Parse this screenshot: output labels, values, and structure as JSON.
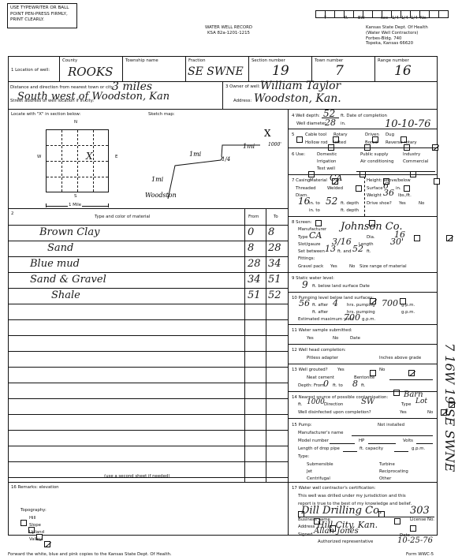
{
  "notice": {
    "line1": "USE TYPEWRITER OR BALL",
    "line2": "POINT PEN-PRESS FIRMLY,",
    "line3": "PRINT CLEARLY."
  },
  "header": {
    "title": "WATER WELL RECORD",
    "statute": "KSA 82a-1201-1215"
  },
  "agency": {
    "line1": "Kansas State Dept. Of Health",
    "line2": "(Water Well Contractors)",
    "line3": "Forbes-Bldg. 740",
    "line4": "Topeka, Kansas 66620"
  },
  "top_code_labels": [
    "T",
    "R",
    "EW",
    "sec",
    "1/4",
    "1/4",
    "1/4",
    "No."
  ],
  "section1": {
    "label": "1  Location of well:",
    "county_label": "County",
    "county": "ROOKS",
    "township_label": "Township name",
    "township": "",
    "fraction_label": "Fraction",
    "fraction": "SE SWNE",
    "section_label": "Section number",
    "section": "19",
    "town_label": "Town number",
    "town": "7",
    "range_label": "Range number",
    "range": "16"
  },
  "distance": {
    "label": "Distance and direction from nearest town or city:",
    "value1": "3 miles",
    "street_label": "Street address of well location if in city:",
    "value2": "South west of Woodston, Kan"
  },
  "section3": {
    "label": "3  Owner of well:",
    "owner": "William Taylor",
    "address_label": "Address:",
    "address": "Woodston, Kan."
  },
  "locate": {
    "label": "Locate with \"X\" in section below:",
    "n": "N",
    "s": "S",
    "e": "E",
    "w": "W",
    "scale": "1 Mile",
    "mark": "X"
  },
  "sketch": {
    "label": "Sketch map:",
    "notes": [
      "1mi",
      "1mi",
      "1/4",
      "1mi",
      "1000'",
      "Woodston",
      "X"
    ]
  },
  "section2": {
    "label": "2",
    "material_header": "Type and color of material",
    "from_header": "From",
    "to_header": "To",
    "rows": [
      {
        "material": "Brown Clay",
        "from": "0",
        "to": "8"
      },
      {
        "material": "Sand",
        "from": "8",
        "to": "28"
      },
      {
        "material": "Blue mud",
        "from": "28",
        "to": "34"
      },
      {
        "material": "Sand & Gravel",
        "from": "34",
        "to": "51"
      },
      {
        "material": "Shale",
        "from": "51",
        "to": "52"
      }
    ],
    "footer": "(use a second sheet if needed)"
  },
  "section4": {
    "label": "4  Well depth:",
    "depth": "52",
    "ft": "ft.  Date of completion",
    "date": "10-10-76",
    "diam_label": "Well diameter",
    "diam": "28",
    "in": "in."
  },
  "section5": {
    "num": "5",
    "options": [
      {
        "label": "Cable tool",
        "checked": false
      },
      {
        "label": "Rotary",
        "checked": false
      },
      {
        "label": "Driven",
        "checked": false
      },
      {
        "label": "Dug",
        "checked": false
      },
      {
        "label": "Hollow rod",
        "checked": false
      },
      {
        "label": "Jetted",
        "checked": false
      },
      {
        "label": "Bored",
        "checked": false
      },
      {
        "label": "Reverse rotary",
        "checked": true
      }
    ]
  },
  "section6": {
    "label": "6  Use:",
    "options": [
      {
        "label": "Domestic",
        "checked": false
      },
      {
        "label": "Public supply",
        "checked": false
      },
      {
        "label": "Industry",
        "checked": false
      },
      {
        "label": "Irrigation",
        "checked": true
      },
      {
        "label": "Air conditioning",
        "checked": false
      },
      {
        "label": "Commercial",
        "checked": false
      },
      {
        "label": "Test well",
        "checked": false
      }
    ]
  },
  "section7": {
    "label": "7  Casing:",
    "material_label": "Material",
    "material": "CA",
    "height_label": "Height: above/below",
    "threaded": "Threaded",
    "welded": "Welded",
    "surface_label": "Surface",
    "surface": "6",
    "in": "in.",
    "diam_label": "Diam.",
    "weight_label": "Weight",
    "weight": "36",
    "weight_unit": "lbs./ft.",
    "diam1": "16",
    "to1": "52",
    "in_to": "in. to",
    "ft_depth": "ft. depth",
    "drive_shoe": "Drive shoe?",
    "yes": "Yes",
    "no": "No",
    "no_checked": true
  },
  "section8": {
    "label": "8  Screen:",
    "manufacturer_label": "Manufacturer",
    "manufacturer": "Johnson Co.",
    "type_label": "Type",
    "type": "CA",
    "dia_label": "Dia.",
    "dia": "16",
    "slot_label": "Slot/gauze",
    "slot": "3/16",
    "length_label": "Length",
    "length": "30'",
    "set_label": "Set between",
    "set_from": "13",
    "ft_and": "ft.  and",
    "set_to": "52",
    "ft": "ft.",
    "fittings": "Fittings:",
    "gravel_label": "Gravel pack",
    "gravel_yes": "Yes",
    "gravel_no": "No",
    "size_range": "Size range of material"
  },
  "section9": {
    "label": "9  Static water level:",
    "value": "9",
    "text": "ft. below land surface   Date"
  },
  "section10": {
    "label": "10  Pumping level below land surfaces:",
    "ft1": "56",
    "hrs1": "4",
    "gpm1": "700",
    "ft_after": "ft.  after",
    "hrs_pumping": "hrs.  pumping",
    "gpm": "g.p.m.",
    "max_label": "Estimated maximum yield",
    "max": "700"
  },
  "section11": {
    "label": "11  Water sample submitted:",
    "yes": "Yes",
    "no": "No",
    "no_checked": true,
    "date": "Date"
  },
  "section12": {
    "label": "12  Well head completion:",
    "pitless": "Pitless adapter",
    "inches": "Inches above grade"
  },
  "section13": {
    "label": "13  Well grouted?",
    "yes": "Yes",
    "no": "No",
    "yes_checked": true,
    "neat": "Neat cement",
    "bentonite": "Bentonite",
    "depth_label": "Depth:  From",
    "from": "0",
    "ft_to": "ft.  to",
    "to": "8",
    "ft": "ft."
  },
  "section14": {
    "label": "14  Nearest source of possible contamination:",
    "contam_value": "Barn",
    "ft_label": "ft.",
    "distance": "1000",
    "direction_label": "Direction",
    "direction": "SW",
    "type_label": "Type",
    "type": "Lot",
    "disinfect_label": "Well disinfected upon completion?",
    "yes": "Yes",
    "no": "No",
    "no_checked": true
  },
  "section15": {
    "label": "15  Pump:",
    "not_installed": "Not installed",
    "not_installed_checked": true,
    "manufacturer": "Manufacturer's name",
    "model": "Model number",
    "hp": "HP",
    "volts": "Volts",
    "drop_pipe": "Length of drop pipe",
    "ft_capacity": "ft.  capacity",
    "gpm": "g.p.m.",
    "type_label": "Type:",
    "types": [
      "Submersible",
      "Turbine",
      "Jet",
      "Reciprocating",
      "Centrifugal",
      "Other"
    ]
  },
  "section16": {
    "label": "16  Remarks:  elevation",
    "topo_label": "Topography:",
    "topo": [
      {
        "label": "Hill",
        "checked": false
      },
      {
        "label": "Slope",
        "checked": false
      },
      {
        "label": "Upland",
        "checked": false
      },
      {
        "label": "Valley",
        "checked": true
      }
    ]
  },
  "section17": {
    "label": "17  Water well contractor's certification:",
    "line1": "This well was drilled under my jurisdiction and this",
    "line2": "report is true to the best of my knowledge and belief.",
    "business": "Dill Drilling Co.",
    "license": "303",
    "business_label": "Business name",
    "license_label": "License No.",
    "address_label": "Address",
    "address": "Hill City, Kan.",
    "signed_label": "Signed",
    "signature": "Allan Jones",
    "date_label": "Date",
    "date": "10-25-76",
    "rep_label": "Authorized representative"
  },
  "footer": {
    "note": "Forward the white, blue and pink copies to the Kansas State Dept. Of Health.",
    "form": "Form WWC-5"
  },
  "margin_note": "7  16W  19  SE SWNE"
}
